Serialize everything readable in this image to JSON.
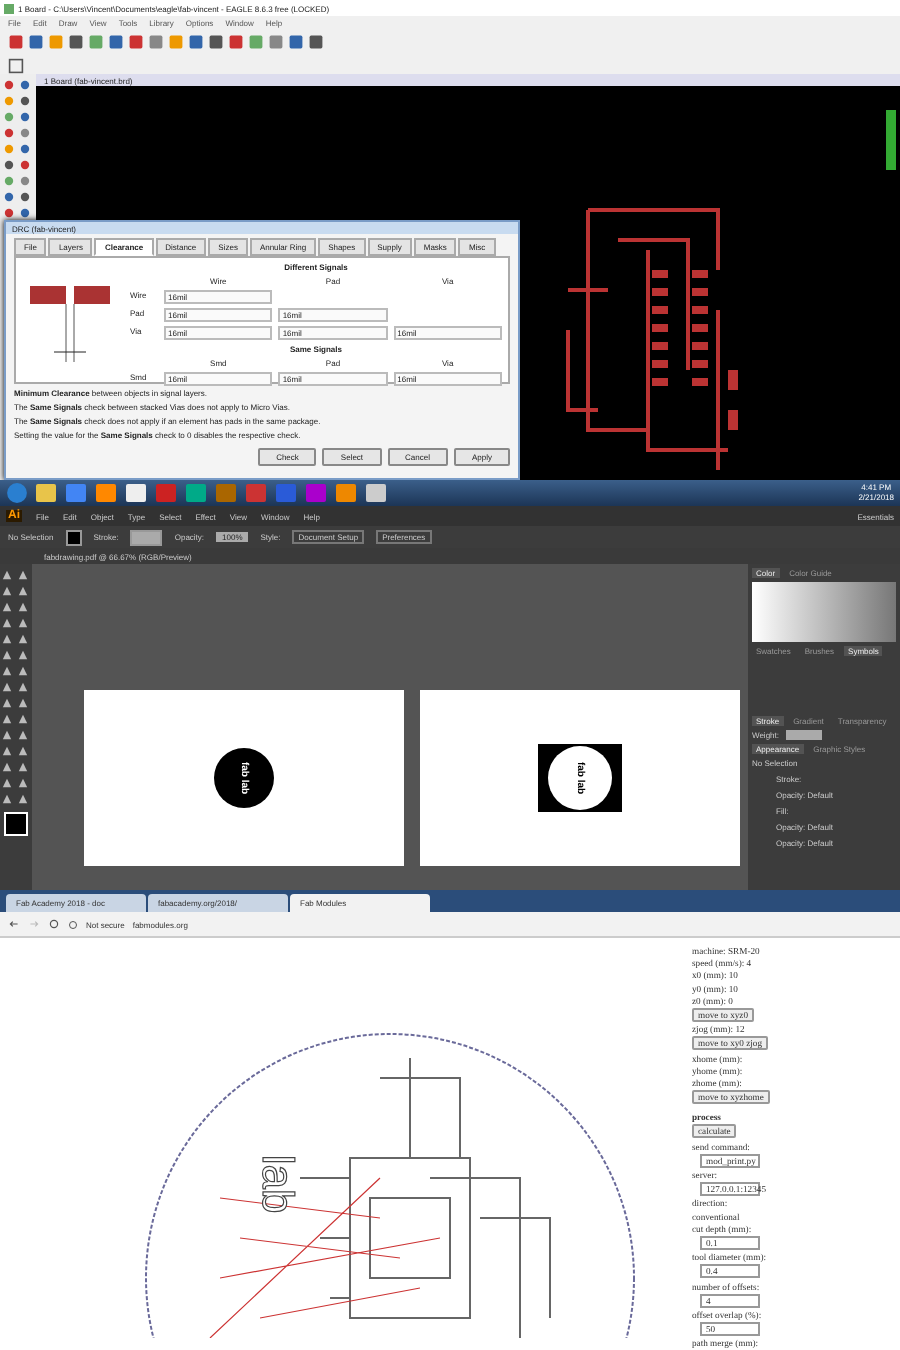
{
  "eagle": {
    "title": "1 Board - C:\\Users\\Vincent\\Documents\\eagle\\fab-vincent - EAGLE 8.6.3 free (LOCKED)",
    "menu": [
      "File",
      "Edit",
      "Draw",
      "View",
      "Tools",
      "Library",
      "Options",
      "Window",
      "Help"
    ],
    "doc_tab": "1 Board (fab-vincent.brd)",
    "drc": {
      "title": "DRC (fab-vincent)",
      "tabs": [
        {
          "label": "File",
          "selected": false
        },
        {
          "label": "Layers",
          "selected": false
        },
        {
          "label": "Clearance",
          "selected": true
        },
        {
          "label": "Distance",
          "selected": false
        },
        {
          "label": "Sizes",
          "selected": false
        },
        {
          "label": "Annular Ring",
          "selected": false
        },
        {
          "label": "Shapes",
          "selected": false
        },
        {
          "label": "Supply",
          "selected": false
        },
        {
          "label": "Masks",
          "selected": false
        },
        {
          "label": "Misc",
          "selected": false
        }
      ],
      "different_heading": "Different Signals",
      "different_columns": [
        "Wire",
        "Pad",
        "Via"
      ],
      "different_rows": [
        {
          "label": "Wire",
          "values": [
            "16mil"
          ]
        },
        {
          "label": "Pad",
          "values": [
            "16mil",
            "16mil"
          ]
        },
        {
          "label": "Via",
          "values": [
            "16mil",
            "16mil",
            "16mil"
          ]
        }
      ],
      "same_heading": "Same Signals",
      "same_columns": [
        "Smd",
        "Pad",
        "Via"
      ],
      "same_rows": [
        {
          "label": "Smd",
          "values": [
            "16mil",
            "16mil",
            "16mil"
          ]
        }
      ],
      "notes": [
        "**Minimum Clearance** between objects in signal layers.",
        "The **Same Signals** check between stacked Vias does not apply to Micro Vias.",
        "The **Same Signals** check does not apply if an element has pads in the same package.",
        "Setting the value for the **Same Signals** check to 0 disables the respective check."
      ],
      "buttons": [
        "Check",
        "Select",
        "Cancel",
        "Apply"
      ]
    }
  },
  "taskbar": {
    "clock_time": "4:41 PM",
    "clock_date": "2/21/2018"
  },
  "illustrator": {
    "logo": "Ai",
    "menu": [
      "File",
      "Edit",
      "Object",
      "Type",
      "Select",
      "Effect",
      "View",
      "Window",
      "Help"
    ],
    "workspace": "Essentials",
    "control_bar": [
      "No Selection",
      "Stroke:",
      "Opacity:",
      "100%",
      "Style:",
      "Document Setup",
      "Preferences"
    ],
    "doc_tab": "fabdrawing.pdf @ 66.67% (RGB/Preview)",
    "artboards": [
      {
        "kind": "circle",
        "text": "fab lab"
      },
      {
        "kind": "square",
        "text": "fab lab"
      }
    ],
    "panel_tabs_top": [
      {
        "label": "Color",
        "selected": true
      },
      {
        "label": "Color Guide",
        "selected": false
      }
    ],
    "panel_tabs_mid": [
      {
        "label": "Swatches",
        "selected": false
      },
      {
        "label": "Brushes",
        "selected": false
      },
      {
        "label": "Symbols",
        "selected": true
      }
    ],
    "panel_tabs_low": [
      {
        "label": "Stroke",
        "selected": true
      },
      {
        "label": "Gradient",
        "selected": false
      },
      {
        "label": "Transparency",
        "selected": false
      }
    ],
    "weight_label": "Weight:",
    "panel_tabs_app": [
      {
        "label": "Appearance",
        "selected": true
      },
      {
        "label": "Graphic Styles",
        "selected": false
      }
    ],
    "appearance": [
      "No Selection",
      "Stroke:",
      "Opacity: Default",
      "Fill:",
      "Opacity: Default",
      "Opacity: Default"
    ]
  },
  "browser": {
    "tabs": [
      {
        "label": "Fab Academy 2018 - doc",
        "selected": false
      },
      {
        "label": "fabacademy.org/2018/",
        "selected": false
      },
      {
        "label": "Fab Modules",
        "selected": true
      }
    ],
    "security": "Not secure",
    "url": "fabmodules.org",
    "canvas_text": "lab",
    "settings": [
      {
        "kind": "label",
        "text": "machine: SRM-20"
      },
      {
        "kind": "label",
        "text": "speed (mm/s): 4"
      },
      {
        "kind": "label",
        "text": "x0 (mm): 10"
      },
      {
        "kind": "label",
        "text": "y0 (mm): 10"
      },
      {
        "kind": "label",
        "text": "z0 (mm): 0"
      },
      {
        "kind": "button",
        "text": "move to xyz0"
      },
      {
        "kind": "label",
        "text": "zjog (mm): 12"
      },
      {
        "kind": "button",
        "text": "move to xy0 zjog"
      },
      {
        "kind": "label",
        "text": "xhome (mm):"
      },
      {
        "kind": "label",
        "text": "yhome (mm):"
      },
      {
        "kind": "label",
        "text": "zhome (mm):"
      },
      {
        "kind": "button",
        "text": "move to xyzhome"
      },
      {
        "kind": "heading",
        "text": "process"
      },
      {
        "kind": "button",
        "text": "calculate"
      },
      {
        "kind": "label",
        "text": "send command:"
      },
      {
        "kind": "field",
        "text": "mod_print.py"
      },
      {
        "kind": "label",
        "text": "server:"
      },
      {
        "kind": "field",
        "text": "127.0.0.1:12345"
      },
      {
        "kind": "label",
        "text": "direction:"
      },
      {
        "kind": "label",
        "text": "conventional"
      },
      {
        "kind": "label",
        "text": "cut depth (mm):"
      },
      {
        "kind": "field",
        "text": "0.1"
      },
      {
        "kind": "label",
        "text": "tool diameter (mm):"
      },
      {
        "kind": "field",
        "text": "0.4"
      },
      {
        "kind": "label",
        "text": "number of offsets:"
      },
      {
        "kind": "field",
        "text": "4"
      },
      {
        "kind": "label",
        "text": "offset overlap (%):"
      },
      {
        "kind": "field",
        "text": "50"
      },
      {
        "kind": "label",
        "text": "path merge (mm):"
      }
    ]
  }
}
